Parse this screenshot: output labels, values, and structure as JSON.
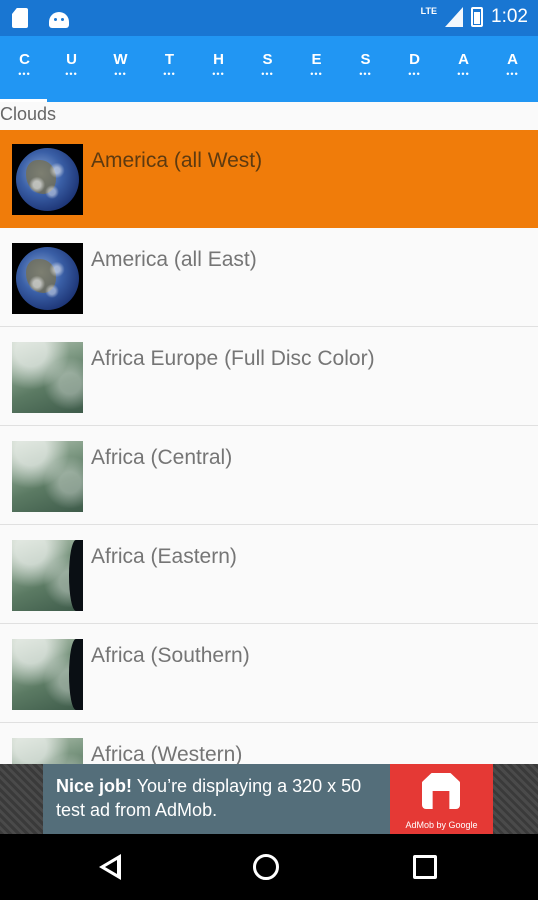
{
  "status_bar": {
    "network_type": "LTE",
    "time": "1:02"
  },
  "tabs": [
    {
      "letter": "C",
      "dots": "•••"
    },
    {
      "letter": "U",
      "dots": "•••"
    },
    {
      "letter": "W",
      "dots": "•••"
    },
    {
      "letter": "T",
      "dots": "•••"
    },
    {
      "letter": "H",
      "dots": "•••"
    },
    {
      "letter": "S",
      "dots": "•••"
    },
    {
      "letter": "E",
      "dots": "•••"
    },
    {
      "letter": "S",
      "dots": "•••"
    },
    {
      "letter": "D",
      "dots": "•••"
    },
    {
      "letter": "A",
      "dots": "•••"
    },
    {
      "letter": "A",
      "dots": "•••"
    }
  ],
  "section_header": "Clouds",
  "items": [
    {
      "title": "America (all West)"
    },
    {
      "title": "America (all East)"
    },
    {
      "title": "Africa Europe (Full Disc Color)"
    },
    {
      "title": "Africa (Central)"
    },
    {
      "title": "Africa (Eastern)"
    },
    {
      "title": "Africa (Southern)"
    },
    {
      "title": "Africa (Western)"
    }
  ],
  "ad": {
    "bold": "Nice job!",
    "text": " You’re displaying a 320 x 50 test ad from AdMob.",
    "logo_caption": "AdMob by Google"
  },
  "colors": {
    "status_bar": "#1976d2",
    "tab_bar": "#2196f3",
    "selected_row": "#f07c0a",
    "ad_background": "#546e7a",
    "ad_logo": "#e53935"
  }
}
